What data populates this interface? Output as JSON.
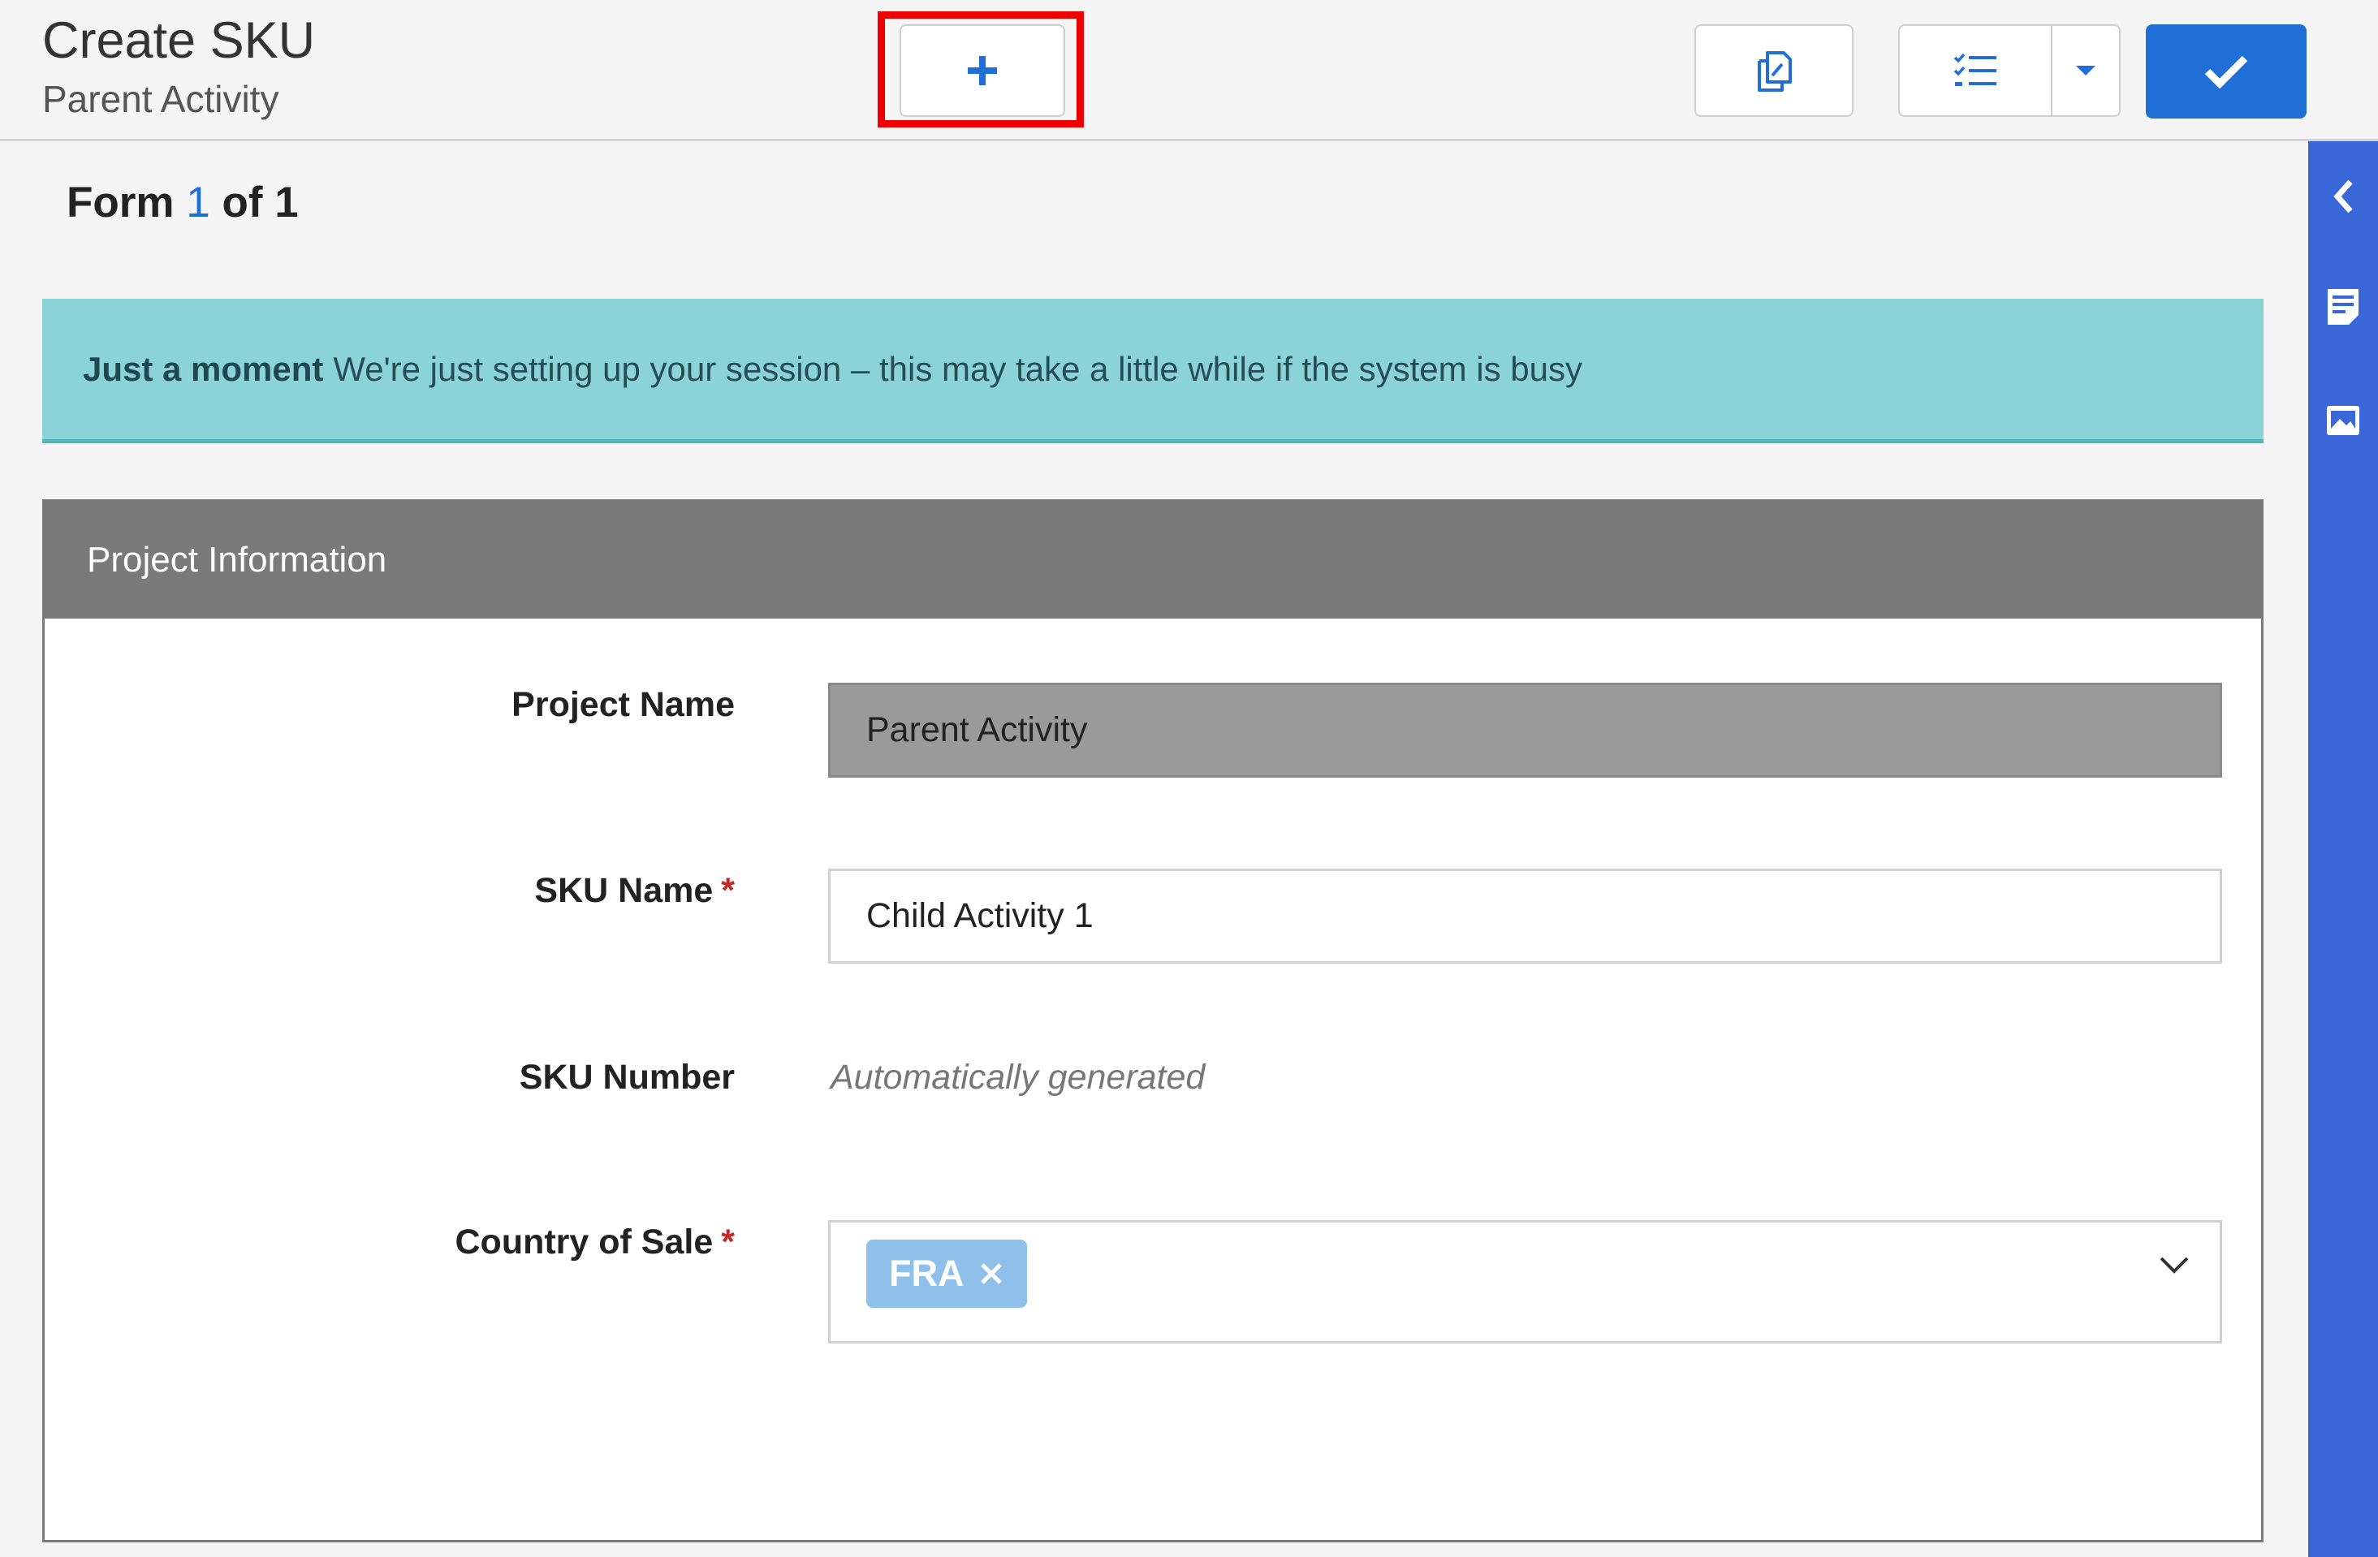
{
  "header": {
    "title": "Create SKU",
    "subtitle": "Parent Activity"
  },
  "toolbar": {
    "add_icon": "plus-icon",
    "copy_icon": "copy-icon",
    "checklist_icon": "checklist-icon",
    "dropdown_icon": "caret-down-icon",
    "save_icon": "check-icon"
  },
  "form_counter": {
    "prefix": "Form ",
    "current": "1",
    "middle": " of ",
    "total": "1"
  },
  "alert": {
    "title": "Just a moment",
    "message": "We're just setting up your session – this may take a little while if the system is busy"
  },
  "panel": {
    "title": "Project Information",
    "fields": {
      "project_name": {
        "label": "Project Name",
        "value": "Parent Activity"
      },
      "sku_name": {
        "label": "SKU Name",
        "required": "*",
        "value": "Child Activity 1"
      },
      "sku_number": {
        "label": "SKU Number",
        "value": "Automatically generated"
      },
      "country": {
        "label": "Country of Sale",
        "required": "*",
        "chip": "FRA"
      }
    }
  },
  "rail": {
    "icons": [
      "chevron-left-icon",
      "document-icon",
      "image-icon"
    ]
  },
  "colors": {
    "accent": "#1f6fd6",
    "rail": "#3967d7",
    "alert_bg": "#8ad3d6",
    "panel_header": "#7a7a7a",
    "highlight": "#ee0000"
  }
}
